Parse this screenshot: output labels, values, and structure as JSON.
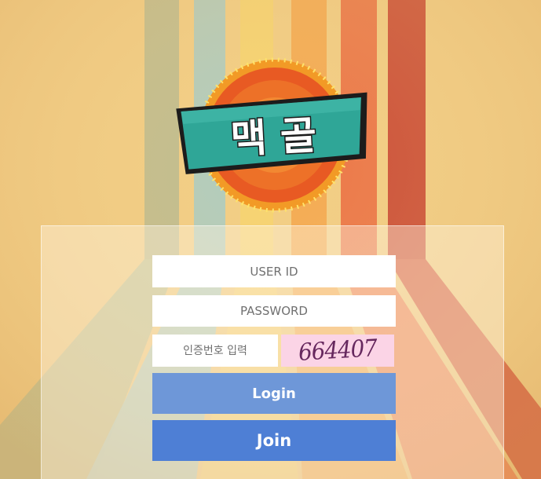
{
  "logo": {
    "text": "맥 골",
    "colors": {
      "badge": "#2fa697",
      "badge_border": "#1c1c1c",
      "sun": "#e85a23",
      "sun_ring": "#f29a26",
      "bulbs": "#ffe36a"
    }
  },
  "login_form": {
    "user_id_placeholder": "USER ID",
    "password_placeholder": "PASSWORD",
    "captcha_placeholder": "인증번호 입력",
    "captcha_code": "664407",
    "login_label": "Login",
    "join_label": "Join"
  },
  "colors": {
    "background": "#f1c97f",
    "login_button": "#6e97d8",
    "join_button": "#4e7fd5",
    "captcha_background": "#fbd4e6",
    "captcha_text": "#66285e",
    "stripes": [
      "#a7b99a",
      "#9ec7c5",
      "#f6d77a",
      "#f3a24b",
      "#e4553a",
      "#c5392a"
    ]
  }
}
